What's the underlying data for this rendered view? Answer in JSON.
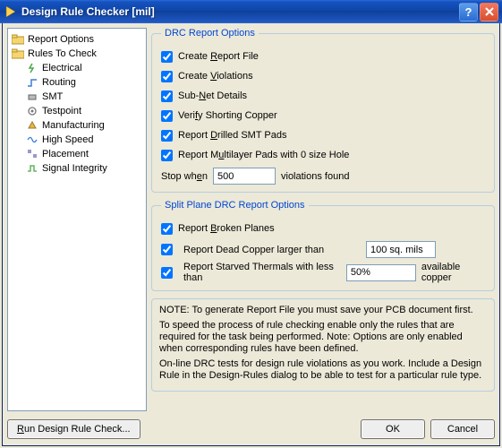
{
  "window": {
    "title": "Design Rule Checker [mil]"
  },
  "tree": {
    "root1": "Report Options",
    "root2": "Rules To Check",
    "children": [
      "Electrical",
      "Routing",
      "SMT",
      "Testpoint",
      "Manufacturing",
      "High Speed",
      "Placement",
      "Signal Integrity"
    ]
  },
  "drc": {
    "legend": "DRC Report Options",
    "createReport": "Create Report File",
    "createViol": "Create Violations",
    "subnet": "Sub-Net Details",
    "shorting": "Verify Shorting Copper",
    "drilled": "Report Drilled SMT Pads",
    "multilayer": "Report Multilayer Pads with 0 size Hole",
    "stopPre": "Stop when",
    "stopVal": "500",
    "stopPost": "violations found"
  },
  "split": {
    "legend": "Split Plane DRC Report Options",
    "broken": "Report Broken Planes",
    "dead": "Report Dead Copper larger than",
    "deadVal": "100 sq. mils",
    "starved": "Report Starved Thermals with less than",
    "starvedVal": "50%",
    "starvedPost": "available copper"
  },
  "note": {
    "l1": "NOTE: To generate Report File you must save your PCB document first.",
    "l2": "To speed the process of rule checking enable only the rules that are required for the task being performed.  Note: Options are only enabled when corresponding rules have been defined.",
    "l3": "On-line DRC tests for design rule violations as you work. Include a Design Rule in the Design-Rules dialog to be able to test for a particular rule  type."
  },
  "buttons": {
    "run": "Run Design Rule Check...",
    "ok": "OK",
    "cancel": "Cancel"
  }
}
